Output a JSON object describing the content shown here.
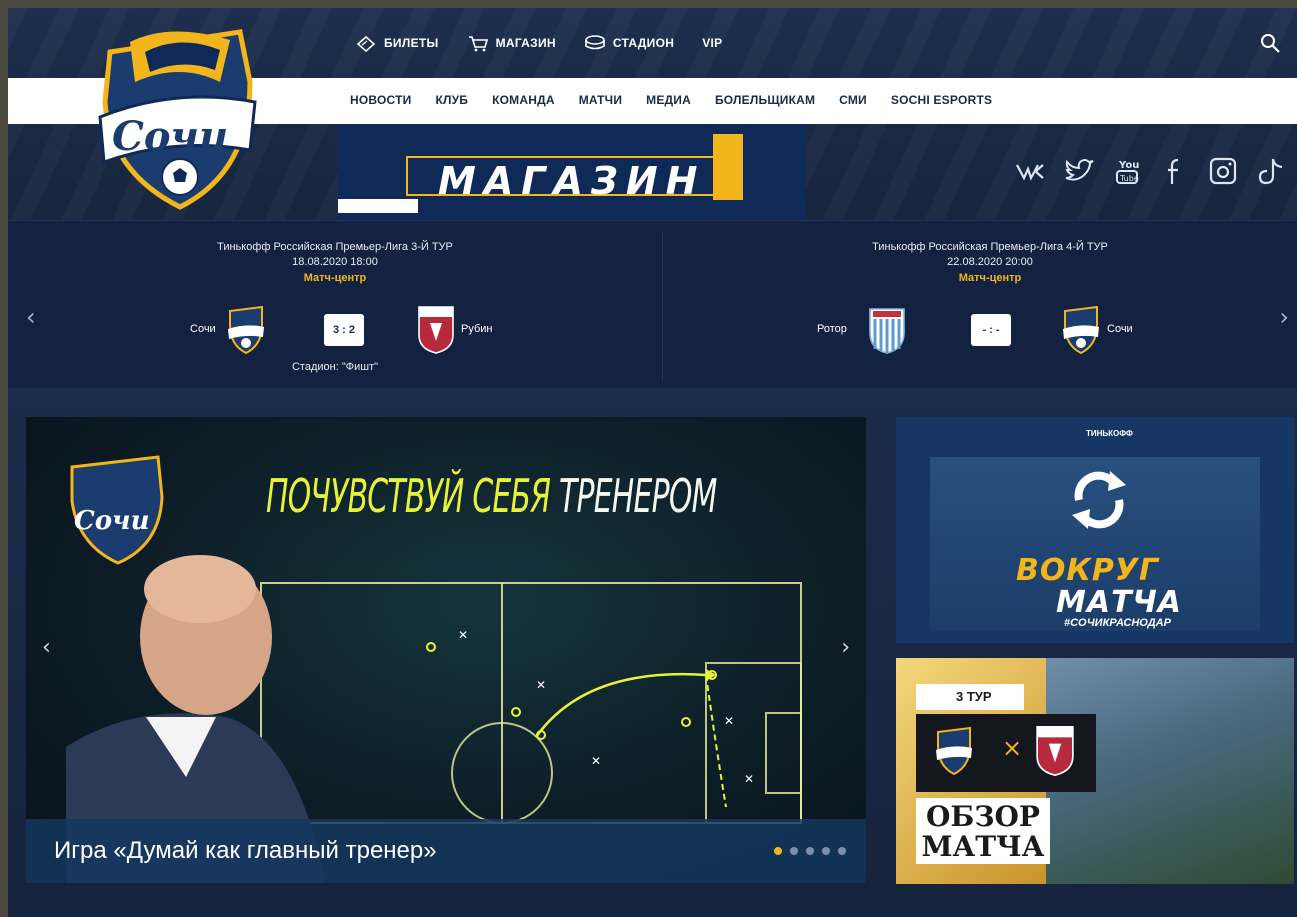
{
  "header": {
    "top_nav": [
      {
        "label": "БИЛЕТЫ",
        "icon": "ticket-icon"
      },
      {
        "label": "МАГАЗИН",
        "icon": "cart-icon"
      },
      {
        "label": "СТАДИОН",
        "icon": "stadium-icon"
      },
      {
        "label": "VIP",
        "icon": ""
      }
    ],
    "main_nav": [
      "НОВОСТИ",
      "КЛУБ",
      "КОМАНДА",
      "МАТЧИ",
      "МЕДИА",
      "БОЛЕЛЬЩИКАМ",
      "СМИ",
      "SOCHI ESPORTS"
    ],
    "shop_banner": "МАГАЗИН",
    "social": [
      "vk-icon",
      "twitter-icon",
      "youtube-icon",
      "facebook-icon",
      "instagram-icon",
      "tiktok-icon"
    ]
  },
  "matches": [
    {
      "league": "Тинькофф Российская Премьер-Лига 3-Й ТУР",
      "date": "18.08.2020 18:00",
      "link": "Матч-центр",
      "home": "Сочи",
      "away": "Рубин",
      "score": "3 : 2",
      "stadium": "Стадион: \"Фишт\""
    },
    {
      "league": "Тинькофф Российская Премьер-Лига 4-Й ТУР",
      "date": "22.08.2020 20:00",
      "link": "Матч-центр",
      "home": "Ротор",
      "away": "Сочи",
      "score": "- : -",
      "stadium": ""
    }
  ],
  "slider": {
    "headline_yellow": "ПОЧУВСТВУЙ СЕБЯ",
    "headline_white": "ТРЕНЕРОМ",
    "caption": "Игра «Думай как главный тренер»",
    "slides": 5,
    "active_slide": 1
  },
  "promo1": {
    "brand": "ТИНЬКОФФ",
    "line1": "ВОКРУГ",
    "line2": "МАТЧА",
    "hashtag_a": "#СОЧИ",
    "hashtag_b": "КРАСНОДАР"
  },
  "promo2": {
    "tour": "3 ТУР",
    "review": "ОБЗОР МАТЧА"
  },
  "colors": {
    "navy": "#17253f",
    "gold": "#f2b51c",
    "white": "#ffffff"
  }
}
